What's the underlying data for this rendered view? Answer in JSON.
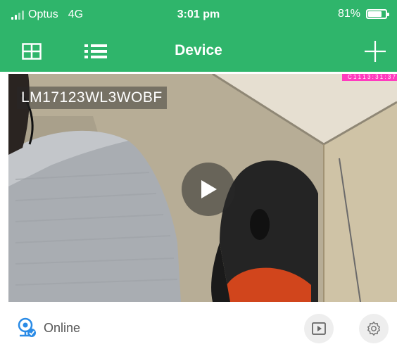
{
  "status_bar": {
    "carrier": "Optus",
    "network": "4G",
    "time": "3:01 pm",
    "battery_text": "81%",
    "battery_level": 0.81
  },
  "nav": {
    "title": "Device",
    "icons": [
      "grid-view-icon",
      "list-view-icon",
      "add-icon"
    ]
  },
  "device": {
    "label": "LM17123WL3WOBF",
    "osd_timestamp": "C 1 1 1 3 : 3 1 : 3 7"
  },
  "footer": {
    "status_text": "Online",
    "icons": [
      "camera-online-icon",
      "playback-icon",
      "settings-icon"
    ]
  },
  "colors": {
    "brand_green": "#2fb56b",
    "online_blue": "#2a8be6"
  }
}
